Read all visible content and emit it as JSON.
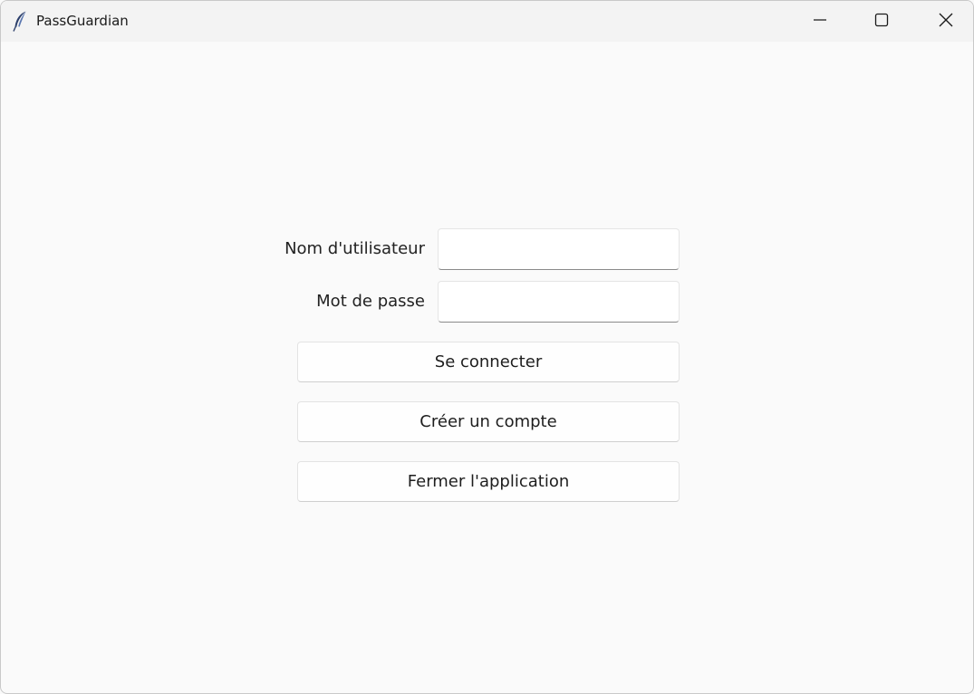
{
  "window": {
    "title": "PassGuardian",
    "app_icon": "feather-icon",
    "controls": {
      "minimize_icon": "minimize-icon",
      "maximize_icon": "maximize-icon",
      "close_icon": "close-icon"
    }
  },
  "form": {
    "username_label": "Nom d'utilisateur",
    "username_value": "",
    "password_label": "Mot de passe",
    "password_value": ""
  },
  "actions": {
    "login_label": "Se connecter",
    "create_account_label": "Créer un compte",
    "close_app_label": "Fermer l'application"
  },
  "colors": {
    "background": "#fafafa",
    "titlebar": "#f3f3f3"
  }
}
